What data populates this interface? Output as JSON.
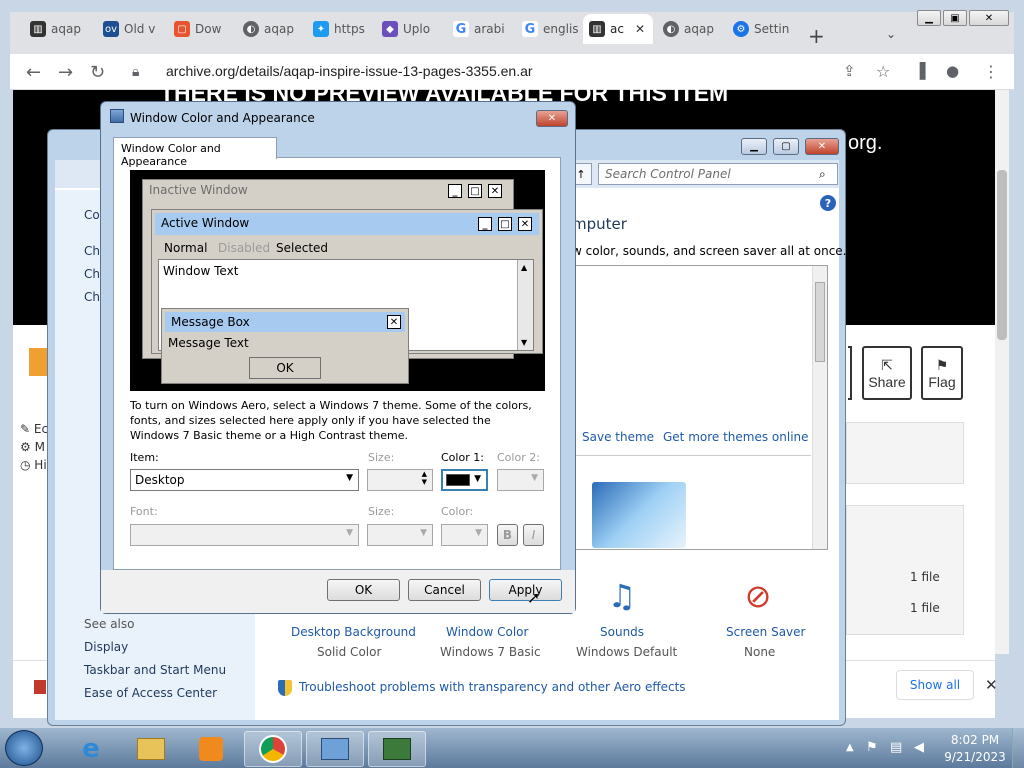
{
  "browser": {
    "tabs": [
      {
        "label": "aqap",
        "icon": "archive-icon"
      },
      {
        "label": "Old v",
        "icon": "ov-icon"
      },
      {
        "label": "Dow",
        "icon": "pdf-icon"
      },
      {
        "label": "aqap",
        "icon": "globe-icon"
      },
      {
        "label": "https",
        "icon": "twitter-icon"
      },
      {
        "label": "Uplo",
        "icon": "upload-icon"
      },
      {
        "label": "arabi",
        "icon": "google-icon"
      },
      {
        "label": "englis",
        "icon": "google-icon"
      },
      {
        "label": "ac",
        "icon": "archive-icon",
        "active": true
      },
      {
        "label": "aqap",
        "icon": "globe-icon"
      },
      {
        "label": "Settin",
        "icon": "gear-icon"
      }
    ],
    "url": "archive.org/details/aqap-inspire-issue-13-pages-3355.en.ar"
  },
  "page": {
    "preview_text": "THERE IS NO PREVIEW AVAILABLE FOR THIS ITEM",
    "org_text": "org.",
    "share_label": "Share",
    "flag_label": "Flag",
    "left_items": [
      "Ec",
      "M",
      "Hi"
    ],
    "files": [
      "1 file",
      "1 file"
    ],
    "show_all": "Show all"
  },
  "control_panel": {
    "search_placeholder": "Search Control Panel",
    "heading": "mputer",
    "desc": "w color, sounds, and screen saver all at once.",
    "left_links": [
      "Co",
      "Ch",
      "Ch",
      "Ch"
    ],
    "save_theme": "Save theme",
    "get_more": "Get more themes online",
    "see_also": "See also",
    "see_also_links": [
      "Display",
      "Taskbar and Start Menu",
      "Ease of Access Center"
    ],
    "items": [
      {
        "title": "Desktop Background",
        "sub": "Solid Color"
      },
      {
        "title": "Window Color",
        "sub": "Windows 7 Basic"
      },
      {
        "title": "Sounds",
        "sub": "Windows Default"
      },
      {
        "title": "Screen Saver",
        "sub": "None"
      }
    ],
    "troubleshoot": "Troubleshoot problems with transparency and other Aero effects"
  },
  "dialog": {
    "title": "Window Color and Appearance",
    "tab": "Window Color and Appearance",
    "preview": {
      "inactive": "Inactive Window",
      "active": "Active Window",
      "menu": [
        "Normal",
        "Disabled",
        "Selected"
      ],
      "window_text": "Window Text",
      "msg_title": "Message Box",
      "msg_text": "Message Text",
      "msg_ok": "OK"
    },
    "info": "To turn on Windows Aero, select a Windows 7 theme.  Some of the colors, fonts, and sizes selected here apply only if you have selected the Windows 7 Basic theme or a High Contrast theme.",
    "item_label": "Item:",
    "item_value": "Desktop",
    "size_label": "Size:",
    "color1_label": "Color 1:",
    "color2_label": "Color 2:",
    "font_label": "Font:",
    "size2_label": "Size:",
    "color_label": "Color:",
    "bold": "B",
    "italic": "I",
    "ok": "OK",
    "cancel": "Cancel",
    "apply": "Apply",
    "color1_value": "#000000"
  },
  "taskbar": {
    "time": "8:02 PM",
    "date": "9/21/2023"
  },
  "colors": {
    "aero": "#bcd3ea",
    "link": "#1e5aa8",
    "active_title": "#a6caf0"
  }
}
